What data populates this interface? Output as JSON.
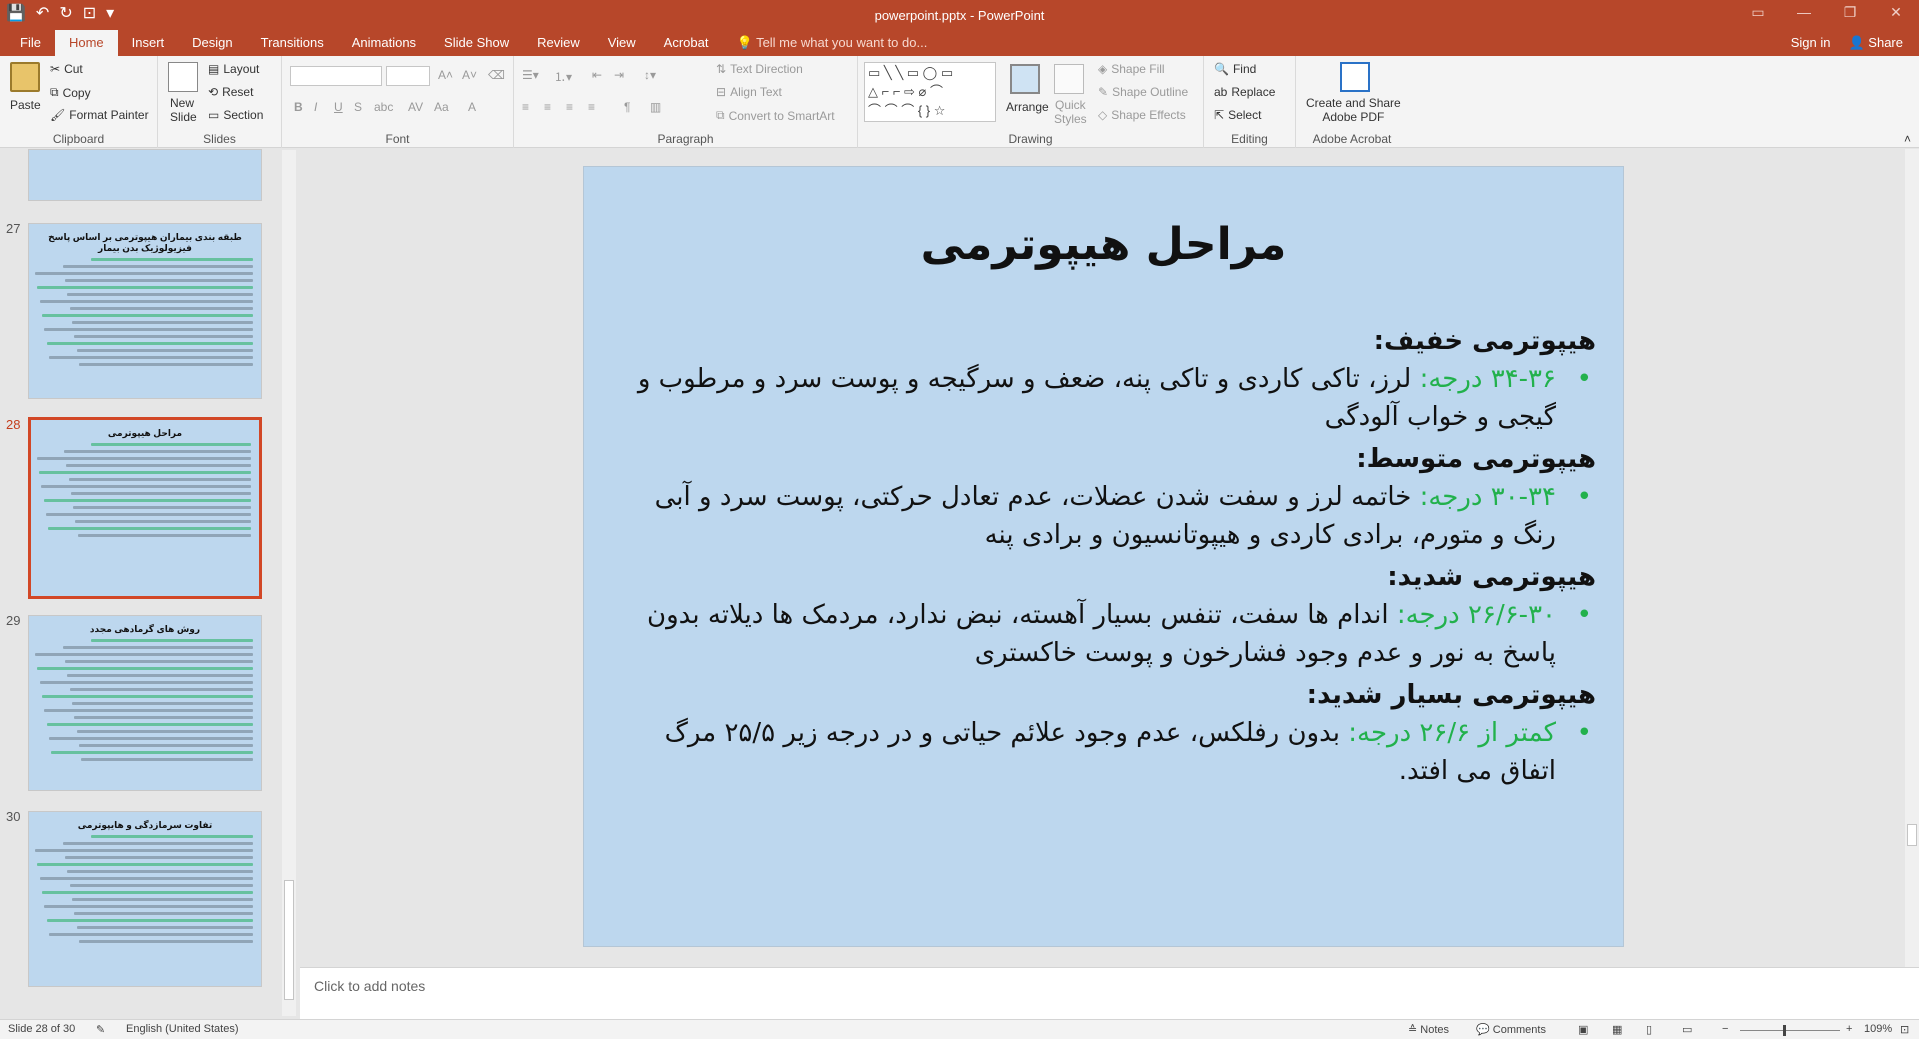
{
  "window": {
    "title": "powerpoint.pptx - PowerPoint",
    "controls": [
      "▭",
      "—",
      "❐",
      "✕"
    ]
  },
  "qat": {
    "save": "💾",
    "undo": "↶",
    "redo": "↻",
    "present": "⊡",
    "more": "▾"
  },
  "tabs": [
    "File",
    "Home",
    "Insert",
    "Design",
    "Transitions",
    "Animations",
    "Slide Show",
    "Review",
    "View",
    "Acrobat"
  ],
  "active_tab": "Home",
  "tell_me": "Tell me what you want to do...",
  "sign_in": "Sign in",
  "share": "Share",
  "ribbon": {
    "clipboard": {
      "label": "Clipboard",
      "paste": "Paste",
      "cut": "Cut",
      "copy": "Copy",
      "format_painter": "Format Painter"
    },
    "slides": {
      "label": "Slides",
      "new_slide": "New",
      "new_slide2": "Slide",
      "layout": "Layout",
      "reset": "Reset",
      "section": "Section"
    },
    "font": {
      "label": "Font",
      "bold": "B",
      "italic": "I",
      "underline": "U",
      "strike": "S",
      "shadow": "abc",
      "spacing": "AV",
      "case": "Aa",
      "color": "A"
    },
    "paragraph": {
      "label": "Paragraph",
      "text_direction": "Text Direction",
      "align_text": "Align Text",
      "convert_smartart": "Convert to SmartArt"
    },
    "drawing": {
      "label": "Drawing",
      "arrange": "Arrange",
      "quick_styles": "Quick",
      "quick_styles2": "Styles",
      "shape_fill": "Shape Fill",
      "shape_outline": "Shape Outline",
      "shape_effects": "Shape Effects"
    },
    "editing": {
      "label": "Editing",
      "find": "Find",
      "replace": "Replace",
      "select": "Select"
    },
    "acrobat": {
      "label": "Adobe Acrobat",
      "create": "Create and Share",
      "create2": "Adobe PDF"
    }
  },
  "thumbnails": [
    {
      "number": "27",
      "title": "طبقه بندی بیماران هیپوترمی بر اساس پاسخ فیزیولوژیک بدن بیمار",
      "lines": 16
    },
    {
      "number": "28",
      "title": "مراحل هیپوترمی",
      "lines": 14
    },
    {
      "number": "29",
      "title": "روش های گرمادهی مجدد",
      "lines": 18
    },
    {
      "number": "30",
      "title": "تفاوت سرمازدگی و هایپوترمی",
      "lines": 16
    }
  ],
  "slide": {
    "title": "مراحل هیپوترمی",
    "sections": [
      {
        "heading": "هیپوترمی خفیف:",
        "range": "۳۴-۳۶ درجه:",
        "text": " لرز، تاکی کاردی و تاکی پنه، ضعف و سرگیجه و پوست سرد و مرطوب و گیجی و خواب آلودگی"
      },
      {
        "heading": "هیپوترمی متوسط:",
        "range": "۳۰-۳۴ درجه:",
        "text": " خاتمه لرز و سفت شدن عضلات، عدم تعادل حرکتی، پوست سرد و آبی رنگ و متورم، برادی کاردی و هیپوتانسیون و برادی پنه"
      },
      {
        "heading": "هیپوترمی شدید:",
        "range": "۲۶/۶-۳۰ درجه:",
        "text": " اندام ها سفت، تنفس بسیار آهسته، نبض ندارد، مردمک ها دیلاته بدون پاسخ به نور و عدم وجود فشارخون و پوست خاکستری"
      },
      {
        "heading": "هیپوترمی بسیار شدید:",
        "range": "کمتر از ۲۶/۶ درجه:",
        "text": " بدون رفلکس، عدم وجود علائم حیاتی و در درجه زیر ۲۵/۵ مرگ اتفاق می افتد."
      }
    ]
  },
  "notes_placeholder": "Click to add notes",
  "status": {
    "slide_info": "Slide 28 of 30",
    "language": "English (United States)",
    "notes": "Notes",
    "comments": "Comments",
    "zoom": "109%"
  },
  "colors": {
    "accent": "#b7472a",
    "slide_bg": "#bdd7ee",
    "bullet_green": "#22b14c"
  }
}
